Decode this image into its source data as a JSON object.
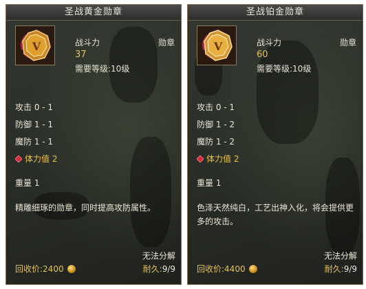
{
  "panels": [
    {
      "title": "圣战黄金勋章",
      "power_label": "战斗力",
      "power_value": "37",
      "level_req": "需要等级:10级",
      "type": "勋章",
      "stats": [
        "攻击 0 - 1",
        "防御 1 - 1",
        "魔防 1 - 1"
      ],
      "vitality": "体力值 2",
      "weight": "重量 1",
      "description": "精雕细琢的勋章，同时提高攻防属性。",
      "no_decompose": "无法分解",
      "recycle_price": "回收价:2400",
      "durability_label": "耐久:",
      "durability_value": "9/9",
      "medal_color": "#e0a030"
    },
    {
      "title": "圣战铂金勋章",
      "power_label": "战斗力",
      "power_value": "60",
      "level_req": "需要等级:10级",
      "type": "勋章",
      "stats": [
        "攻击 0 - 1",
        "防御 1 - 2",
        "魔防 1 - 2"
      ],
      "vitality": "体力值 2",
      "weight": "重量 1",
      "description": "色泽天然纯白，工艺出神入化，将会提供更多的攻击。",
      "no_decompose": "无法分解",
      "recycle_price": "回收价:4400",
      "durability_label": "耐久:",
      "durability_value": "9/9",
      "medal_color": "#e8b040"
    }
  ]
}
